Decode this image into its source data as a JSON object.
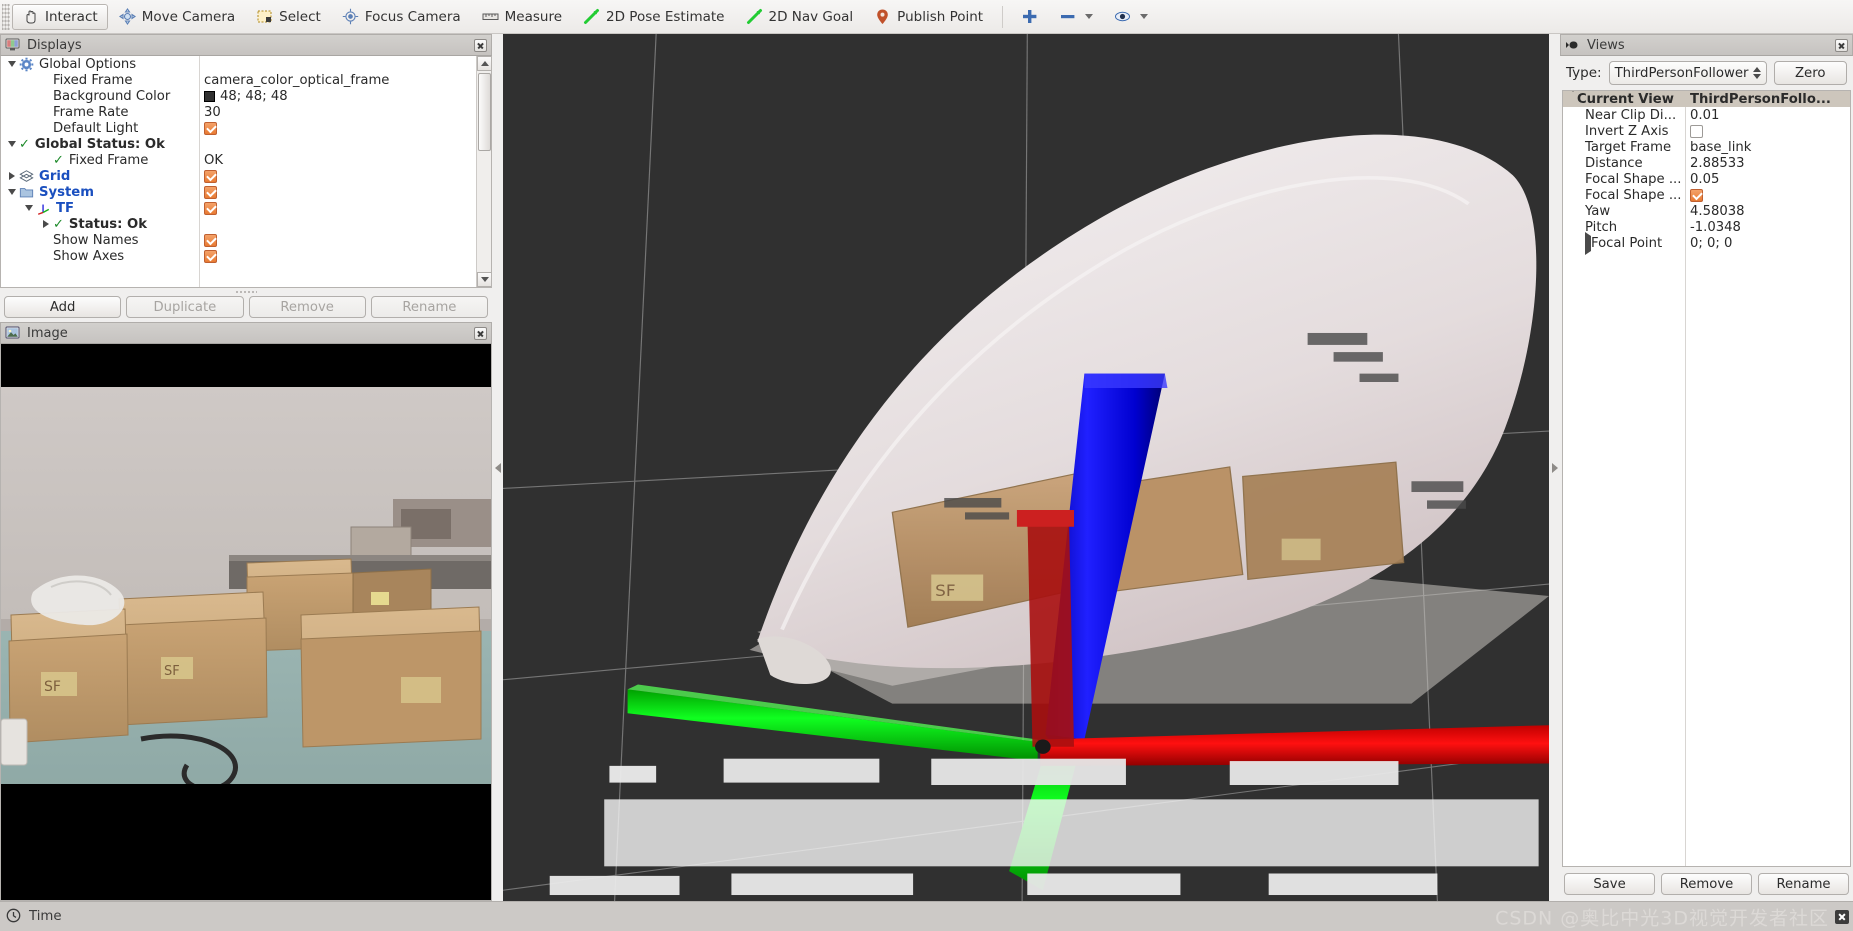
{
  "toolbar": {
    "items": [
      {
        "label": "Interact",
        "icon": "hand-icon",
        "checked": true
      },
      {
        "label": "Move Camera",
        "icon": "move-camera-icon",
        "checked": false
      },
      {
        "label": "Select",
        "icon": "select-icon",
        "checked": false
      },
      {
        "label": "Focus Camera",
        "icon": "focus-camera-icon",
        "checked": false
      },
      {
        "label": "Measure",
        "icon": "measure-icon",
        "checked": false
      },
      {
        "label": "2D Pose Estimate",
        "icon": "pose-arrow-icon",
        "checked": false
      },
      {
        "label": "2D Nav Goal",
        "icon": "nav-arrow-icon",
        "checked": false
      },
      {
        "label": "Publish Point",
        "icon": "map-pin-icon",
        "checked": false
      }
    ],
    "extras": [
      {
        "icon": "plus-icon",
        "dropdown": false
      },
      {
        "icon": "minus-icon",
        "dropdown": true
      },
      {
        "icon": "eye-icon",
        "dropdown": true
      }
    ]
  },
  "displays": {
    "title": "Displays",
    "rows": [
      {
        "indent": 0,
        "expander": "down",
        "icon": "gear-icon",
        "label": "Global Options",
        "style": "plain",
        "value_type": "none",
        "value": ""
      },
      {
        "indent": 2,
        "expander": "none",
        "icon": "none",
        "label": "Fixed Frame",
        "style": "plain",
        "value_type": "text",
        "value": "camera_color_optical_frame"
      },
      {
        "indent": 2,
        "expander": "none",
        "icon": "none",
        "label": "Background Color",
        "style": "plain",
        "value_type": "swatch",
        "value": "48; 48; 48",
        "color": "#303030"
      },
      {
        "indent": 2,
        "expander": "none",
        "icon": "none",
        "label": "Frame Rate",
        "style": "plain",
        "value_type": "text",
        "value": "30"
      },
      {
        "indent": 2,
        "expander": "none",
        "icon": "none",
        "label": "Default Light",
        "style": "plain",
        "value_type": "check",
        "value": ""
      },
      {
        "indent": 0,
        "expander": "down",
        "icon": "ok-check",
        "label": "Global Status: Ok",
        "style": "bold",
        "value_type": "none",
        "value": ""
      },
      {
        "indent": 2,
        "expander": "none",
        "icon": "ok-check",
        "label": "Fixed Frame",
        "style": "plain",
        "value_type": "text",
        "value": "OK"
      },
      {
        "indent": 0,
        "expander": "right",
        "icon": "grid-icon",
        "label": "Grid",
        "style": "blue",
        "value_type": "check",
        "value": ""
      },
      {
        "indent": 0,
        "expander": "down",
        "icon": "folder-icon",
        "label": "System",
        "style": "blue",
        "value_type": "check",
        "value": ""
      },
      {
        "indent": 1,
        "expander": "down",
        "icon": "tf-axes-icon",
        "label": "TF",
        "style": "blue",
        "value_type": "check",
        "value": ""
      },
      {
        "indent": 2,
        "expander": "right",
        "icon": "ok-check",
        "label": "Status: Ok",
        "style": "bold",
        "value_type": "none",
        "value": ""
      },
      {
        "indent": 2,
        "expander": "none",
        "icon": "none",
        "label": "Show Names",
        "style": "plain",
        "value_type": "check",
        "value": ""
      },
      {
        "indent": 2,
        "expander": "none",
        "icon": "none",
        "label": "Show Axes",
        "style": "plain",
        "value_type": "check",
        "value": ""
      }
    ],
    "buttons": [
      {
        "label": "Add",
        "enabled": true
      },
      {
        "label": "Duplicate",
        "enabled": false
      },
      {
        "label": "Remove",
        "enabled": false
      },
      {
        "label": "Rename",
        "enabled": false
      }
    ]
  },
  "image_panel": {
    "title": "Image"
  },
  "views": {
    "title": "Views",
    "type_label": "Type:",
    "type_value": "ThirdPersonFollower",
    "zero_label": "Zero",
    "rows": [
      {
        "indent": 0,
        "expander": "down",
        "label": "Current View",
        "style": "header",
        "value_type": "text",
        "value": "ThirdPersonFollo..."
      },
      {
        "indent": 1,
        "expander": "none",
        "label": "Near Clip Di...",
        "style": "plain",
        "value_type": "text",
        "value": "0.01"
      },
      {
        "indent": 1,
        "expander": "none",
        "label": "Invert Z Axis",
        "style": "plain",
        "value_type": "uncheck",
        "value": ""
      },
      {
        "indent": 1,
        "expander": "none",
        "label": "Target Frame",
        "style": "plain",
        "value_type": "text",
        "value": "base_link"
      },
      {
        "indent": 1,
        "expander": "none",
        "label": "Distance",
        "style": "plain",
        "value_type": "text",
        "value": "2.88533"
      },
      {
        "indent": 1,
        "expander": "none",
        "label": "Focal Shape ...",
        "style": "plain",
        "value_type": "text",
        "value": "0.05"
      },
      {
        "indent": 1,
        "expander": "none",
        "label": "Focal Shape ...",
        "style": "plain",
        "value_type": "check",
        "value": ""
      },
      {
        "indent": 1,
        "expander": "none",
        "label": "Yaw",
        "style": "plain",
        "value_type": "text",
        "value": "4.58038"
      },
      {
        "indent": 1,
        "expander": "none",
        "label": "Pitch",
        "style": "plain",
        "value_type": "text",
        "value": "-1.0348"
      },
      {
        "indent": 1,
        "expander": "right",
        "label": "Focal Point",
        "style": "plain",
        "value_type": "text",
        "value": "0; 0; 0"
      }
    ],
    "buttons": [
      {
        "label": "Save"
      },
      {
        "label": "Remove"
      },
      {
        "label": "Rename"
      }
    ]
  },
  "statusbar": {
    "label": "Time",
    "icon": "clock-icon",
    "watermark": "CSDN @奥比中光3D视觉开发者社区"
  },
  "colors": {
    "viewport_background": "#303030",
    "axis_x": "#ff0000",
    "axis_y": "#00e000",
    "axis_z": "#0000ff",
    "checkbox_accent": "#e87a33",
    "tree_item_blue": "#1a4fbf"
  }
}
